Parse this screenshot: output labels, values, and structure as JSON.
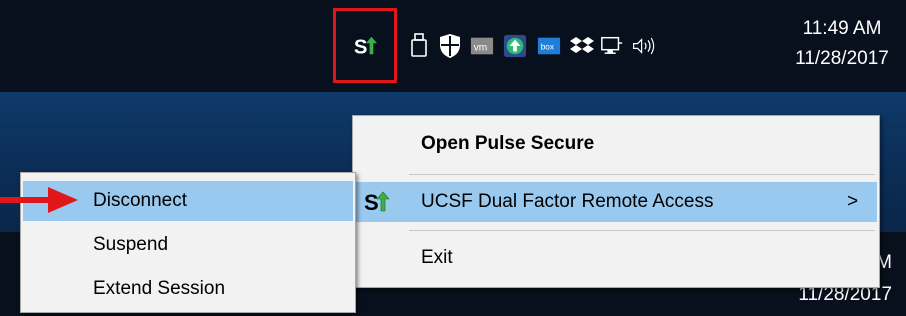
{
  "tray": {
    "time": "11:49 AM",
    "date": "11/28/2017",
    "date_bottom": "11/28/2017",
    "time_bottom_fragment": "M",
    "icons": [
      "pulse-secure-icon",
      "usb-drive-icon",
      "windows-defender-icon",
      "vmware-icon",
      "upload-icon",
      "box-icon",
      "dropbox-icon",
      "network-icon",
      "volume-icon"
    ],
    "vmware_text": "vm",
    "box_text": "box"
  },
  "main_menu": {
    "open": "Open Pulse Secure",
    "connection": "UCSF Dual Factor Remote Access",
    "submenu_arrow": ">",
    "exit": "Exit"
  },
  "sub_menu": {
    "disconnect": "Disconnect",
    "suspend": "Suspend",
    "extend": "Extend Session"
  },
  "colors": {
    "highlight_box": "#e0161b",
    "menu_hover": "#99c9ef",
    "menu_bg": "#f2f2f2",
    "taskbar": "#07101c",
    "pointer_arrow": "#e0161b"
  }
}
